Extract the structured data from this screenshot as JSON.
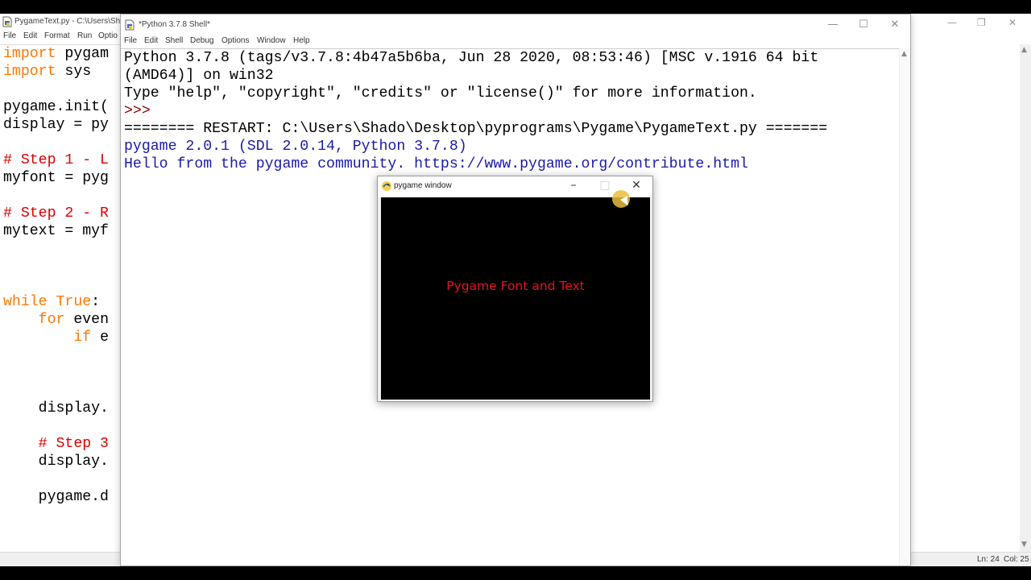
{
  "editor": {
    "title": "PygameText.py - C:\\Users\\Sha",
    "menu": [
      "File",
      "Edit",
      "Format",
      "Run",
      "Optio"
    ],
    "code": [
      {
        "text": "import pygam",
        "row": 0,
        "kind": "import"
      },
      {
        "text": "import sys",
        "row": 1,
        "kind": "import"
      },
      {
        "text": "pygame.init(",
        "row": 3,
        "kind": "plain"
      },
      {
        "text": "display = py",
        "row": 4,
        "kind": "plain"
      },
      {
        "text": "# Step 1 - L",
        "row": 6,
        "kind": "comment"
      },
      {
        "text": "myfont = pyg",
        "row": 7,
        "kind": "plain"
      },
      {
        "text": "# Step 2 - R",
        "row": 9,
        "kind": "comment"
      },
      {
        "text": "mytext = myf",
        "row": 10,
        "kind": "plain"
      },
      {
        "text": "while True:",
        "row": 14,
        "kind": "while"
      },
      {
        "text": "    for even",
        "row": 15,
        "kind": "for"
      },
      {
        "text": "        if e",
        "row": 16,
        "kind": "if"
      },
      {
        "text": "    display.",
        "row": 20,
        "kind": "plain"
      },
      {
        "text": "    # Step 3",
        "row": 22,
        "kind": "comment"
      },
      {
        "text": "    display.",
        "row": 23,
        "kind": "plain"
      },
      {
        "text": "    pygame.d",
        "row": 25,
        "kind": "plain"
      }
    ],
    "status": {
      "line": "Ln: 24",
      "col": "Col: 25"
    }
  },
  "shell": {
    "title": "*Python 3.7.8 Shell*",
    "menu": [
      "File",
      "Edit",
      "Shell",
      "Debug",
      "Options",
      "Window",
      "Help"
    ],
    "lines": [
      {
        "text": "Python 3.7.8 (tags/v3.7.8:4b47a5b6ba, Jun 28 2020, 08:53:46) [MSC v.1916 64 bit",
        "style": "plain"
      },
      {
        "text": "(AMD64)] on win32",
        "style": "plain"
      },
      {
        "text": "Type \"help\", \"copyright\", \"credits\" or \"license()\" for more information.",
        "style": "plain"
      },
      {
        "text": ">>> ",
        "style": "prompt"
      },
      {
        "text": "======== RESTART: C:\\Users\\Shado\\Desktop\\pyprograms\\Pygame\\PygameText.py =======",
        "style": "plain"
      },
      {
        "text": "pygame 2.0.1 (SDL 2.0.14, Python 3.7.8)",
        "style": "blue"
      },
      {
        "text": "Hello from the pygame community. https://www.pygame.org/contribute.html",
        "style": "blue"
      }
    ]
  },
  "pygame_window": {
    "title": "pygame window",
    "text": "Pygame Font and Text",
    "text_color": "#e8121a",
    "background": "#000000"
  },
  "colors": {
    "keyword": "#ff7700",
    "comment": "#dd0000",
    "prompt": "#8b0000",
    "stdout_blue": "#1a1aa8"
  }
}
